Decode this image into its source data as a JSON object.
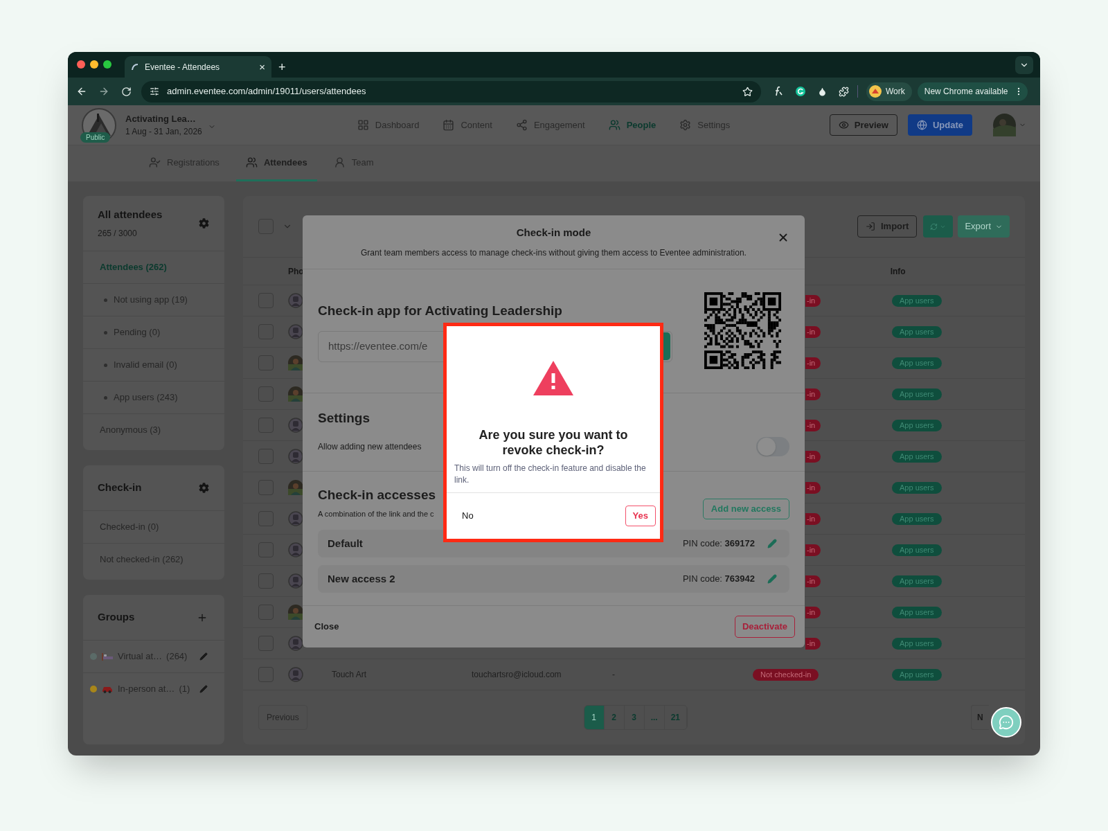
{
  "browser": {
    "tab_title": "Eventee - Attendees",
    "tab_close": "×",
    "new_tab": "+",
    "url": "admin.eventee.com/admin/19011/users/attendees",
    "profile": "Work",
    "update_chip": "New Chrome available"
  },
  "header": {
    "event_badge": "Public",
    "event_name": "Activating Lea…",
    "event_dates": "1 Aug - 31 Jan, 2026",
    "nav": [
      {
        "label": "Dashboard",
        "selected": false
      },
      {
        "label": "Content",
        "selected": false
      },
      {
        "label": "Engagement",
        "selected": false
      },
      {
        "label": "People",
        "selected": true
      },
      {
        "label": "Settings",
        "selected": false
      }
    ],
    "preview": "Preview",
    "update": "Update"
  },
  "subtabs": [
    {
      "label": "Registrations",
      "selected": false
    },
    {
      "label": "Attendees",
      "selected": true
    },
    {
      "label": "Team",
      "selected": false
    }
  ],
  "sidebar": {
    "panels": [
      {
        "kind": "settings",
        "title": "All attendees",
        "count": "265 / 3000",
        "items": [
          {
            "label": "Attendees (262)",
            "kind": "main",
            "selected": true
          },
          {
            "label": "Not using app (19)",
            "kind": "sub",
            "selected": false
          },
          {
            "label": "Pending (0)",
            "kind": "sub",
            "selected": false
          },
          {
            "label": "Invalid email (0)",
            "kind": "sub",
            "selected": false
          },
          {
            "label": "App users (243)",
            "kind": "sub",
            "selected": false
          },
          {
            "label": "Anonymous (3)",
            "kind": "main",
            "selected": false
          }
        ]
      },
      {
        "kind": "settings",
        "title": "Check-in",
        "items": [
          {
            "label": "Checked-in (0)",
            "kind": "main",
            "selected": false
          },
          {
            "label": "Not checked-in (262)",
            "kind": "main",
            "selected": false
          }
        ]
      }
    ],
    "groups": {
      "title": "Groups",
      "items": [
        {
          "kind": "bed",
          "name": "Virtual at…",
          "count": "(264)",
          "color": "#5b6b68"
        },
        {
          "kind": "car",
          "name": "In-person at…",
          "count": "(1)",
          "color": "#a8861a"
        }
      ]
    }
  },
  "toolbar": {
    "select_all_checked": false,
    "import": "Import",
    "export": "Export"
  },
  "table": {
    "columns": [
      {
        "label": "Pho"
      },
      {
        "label": "Info"
      }
    ],
    "rows": [
      {
        "checked": false,
        "kind": "placeholder",
        "status": "-in",
        "info": "App users"
      },
      {
        "checked": false,
        "kind": "placeholder",
        "status": "-in",
        "info": "App users"
      },
      {
        "checked": false,
        "status": "-in",
        "info": "App users"
      },
      {
        "checked": false,
        "status": "-in",
        "info": "App users"
      },
      {
        "checked": false,
        "kind": "placeholder",
        "status": "-in",
        "info": "App users"
      },
      {
        "checked": false,
        "kind": "placeholder",
        "status": "-in",
        "info": "App users"
      },
      {
        "checked": false,
        "status": "-in",
        "info": "App users"
      },
      {
        "checked": false,
        "kind": "placeholder",
        "status": "-in",
        "info": "App users"
      },
      {
        "checked": false,
        "kind": "placeholder",
        "status": "-in",
        "info": "App users"
      },
      {
        "checked": false,
        "kind": "placeholder",
        "status": "-in",
        "info": "App users"
      },
      {
        "checked": false,
        "status": "-in",
        "info": "App users"
      },
      {
        "checked": false,
        "kind": "placeholder",
        "status": "-in",
        "info": "App users"
      },
      {
        "checked": false,
        "kind": "placeholder",
        "name": "Touch Art",
        "email": "touchartsro@icloud.com",
        "company": "-",
        "status": "Not checked-in",
        "info": "App users"
      }
    ]
  },
  "pagination": {
    "previous": "Previous",
    "next": "N",
    "pages": [
      {
        "label": "1",
        "selected": true
      },
      {
        "label": "2",
        "selected": false
      },
      {
        "label": "3",
        "selected": false
      },
      {
        "label": "...",
        "selected": false
      },
      {
        "label": "21",
        "selected": false
      }
    ]
  },
  "modal": {
    "title": "Check-in mode",
    "subtitle": "Grant team members access to manage check-ins without giving them access to Eventee administration.",
    "app_title": "Check-in app for Activating Leadership",
    "url": "https://eventee.com/e",
    "settings_title": "Settings",
    "toggle": {
      "label": "Allow adding new attendees",
      "on": false
    },
    "accesses_title": "Check-in accesses",
    "accesses_description": "A combination of the link and the c",
    "add_access": "Add new access",
    "accesses": [
      {
        "name": "Default",
        "pin_label": "PIN code:",
        "pin": "369172"
      },
      {
        "name": "New access 2",
        "pin_label": "PIN code:",
        "pin": "763942"
      }
    ],
    "close": "Close",
    "deactivate": "Deactivate"
  },
  "confirm": {
    "title": "Are you sure you want to revoke check-in?",
    "message": "This will turn off the check-in feature and disable the link.",
    "no": "No",
    "yes": "Yes"
  }
}
